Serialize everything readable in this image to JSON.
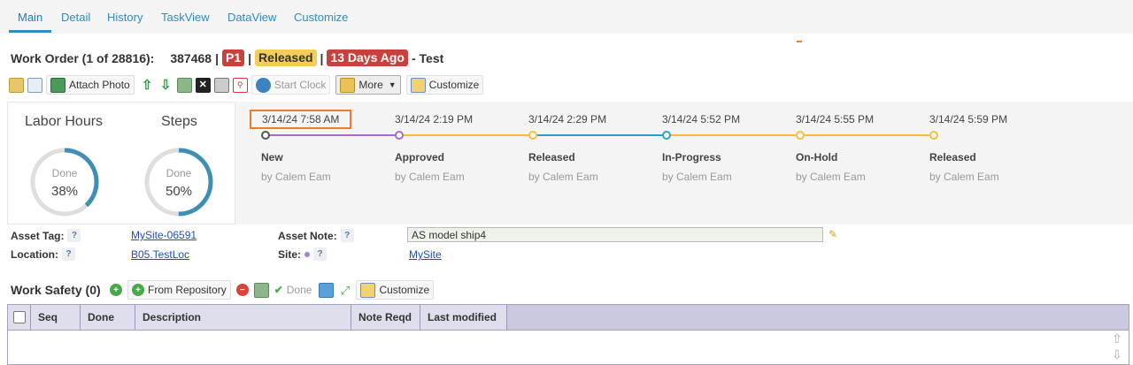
{
  "tabs": [
    "Main",
    "Detail",
    "History",
    "TaskView",
    "DataView",
    "Customize"
  ],
  "work_order": {
    "prefix": "Work Order (1 of 28816):",
    "number": "387468",
    "priority": "P1",
    "status": "Released",
    "age": "13 Days Ago",
    "suffix": "- Test",
    "sep": "|"
  },
  "toolbar": {
    "attach_photo": "Attach Photo",
    "start_clock": "Start Clock",
    "more": "More",
    "customize": "Customize"
  },
  "stats": {
    "labor_hours": {
      "label": "Labor Hours",
      "done_label": "Done",
      "percent_text": "38%",
      "percent": 38
    },
    "steps": {
      "label": "Steps",
      "done_label": "Done",
      "percent_text": "50%",
      "percent": 50
    }
  },
  "timeline": [
    {
      "date": "3/14/24 7:58 AM",
      "status": "New",
      "by": "by Calem Eam",
      "color": "#555555"
    },
    {
      "date": "3/14/24 2:19 PM",
      "status": "Approved",
      "by": "by Calem Eam",
      "color": "#a070c0"
    },
    {
      "date": "3/14/24 2:29 PM",
      "status": "Released",
      "by": "by Calem Eam",
      "color": "#f0c040"
    },
    {
      "date": "3/14/24 5:52 PM",
      "status": "In-Progress",
      "by": "by Calem Eam",
      "color": "#2aa0c8"
    },
    {
      "date": "3/14/24 5:55 PM",
      "status": "On-Hold",
      "by": "by Calem Eam",
      "color": "#f0c040"
    },
    {
      "date": "3/14/24 5:59 PM",
      "status": "Released",
      "by": "by Calem Eam",
      "color": "#f0c040"
    }
  ],
  "fields": {
    "asset_tag_label": "Asset Tag:",
    "asset_tag_value": "MySite-06591",
    "location_label": "Location:",
    "location_value": "B05.TestLoc",
    "asset_note_label": "Asset Note:",
    "asset_note_value": "AS model ship4",
    "site_label": "Site:",
    "site_value": "MySite",
    "help": "?"
  },
  "work_safety": {
    "title": "Work Safety (0)",
    "from_repository": "From Repository",
    "done": "Done",
    "customize": "Customize",
    "columns": [
      "Seq",
      "Done",
      "Description",
      "Note Reqd",
      "Last modified"
    ]
  },
  "icons": {
    "up_arrow": "up-arrow-icon",
    "down_arrow": "down-arrow-icon",
    "pencil": "pencil-icon"
  }
}
